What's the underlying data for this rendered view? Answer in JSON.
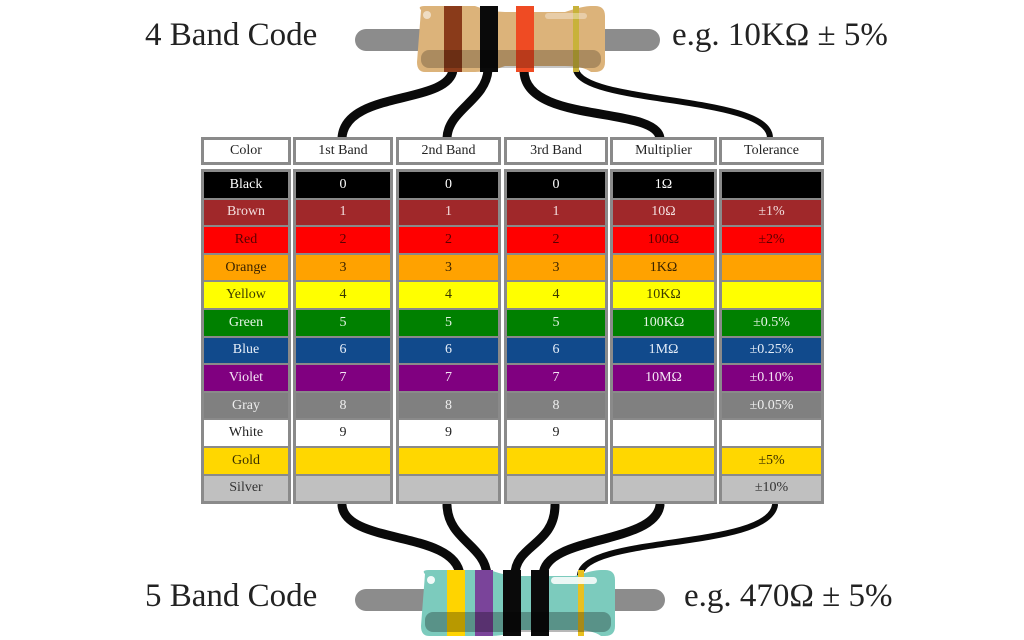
{
  "top": {
    "title": "4 Band Code",
    "example": "e.g.  10KΩ ± 5%",
    "body_color": "#dcb37a",
    "bands": [
      {
        "name": "brown",
        "color": "#8a3b1a"
      },
      {
        "name": "black",
        "color": "#0a0a0a"
      },
      {
        "name": "orange",
        "color": "#ef4b23"
      },
      {
        "name": "gold",
        "color": "#c8b23a"
      }
    ]
  },
  "bottom": {
    "title": "5 Band Code",
    "example": "e.g.  470Ω ± 5%",
    "body_color": "#7ccbbd",
    "bands": [
      {
        "name": "yellow",
        "color": "#ffd400"
      },
      {
        "name": "violet",
        "color": "#7a449a"
      },
      {
        "name": "black",
        "color": "#0a0a0a"
      },
      {
        "name": "black",
        "color": "#0a0a0a"
      },
      {
        "name": "gold",
        "color": "#e8c020"
      }
    ]
  },
  "table": {
    "headers": [
      "Color",
      "1st Band",
      "2nd Band",
      "3rd Band",
      "Multiplier",
      "Tolerance"
    ],
    "rows": [
      {
        "color": "Black",
        "bg": "#000000",
        "fg": "#ffffff",
        "first": "0",
        "second": "0",
        "third": "0",
        "multiplier": "1Ω",
        "tolerance": ""
      },
      {
        "color": "Brown",
        "bg": "#a0282a",
        "fg": "#f2dede",
        "first": "1",
        "second": "1",
        "third": "1",
        "multiplier": "10Ω",
        "tolerance": "±1%"
      },
      {
        "color": "Red",
        "bg": "#ff0000",
        "fg": "#5a0000",
        "first": "2",
        "second": "2",
        "third": "2",
        "multiplier": "100Ω",
        "tolerance": "±2%"
      },
      {
        "color": "Orange",
        "bg": "#ffa200",
        "fg": "#3a2400",
        "first": "3",
        "second": "3",
        "third": "3",
        "multiplier": "1KΩ",
        "tolerance": ""
      },
      {
        "color": "Yellow",
        "bg": "#ffff00",
        "fg": "#3a3a00",
        "first": "4",
        "second": "4",
        "third": "4",
        "multiplier": "10KΩ",
        "tolerance": ""
      },
      {
        "color": "Green",
        "bg": "#008000",
        "fg": "#e6f4e6",
        "first": "5",
        "second": "5",
        "third": "5",
        "multiplier": "100KΩ",
        "tolerance": "±0.5%"
      },
      {
        "color": "Blue",
        "bg": "#114a8c",
        "fg": "#e6eef8",
        "first": "6",
        "second": "6",
        "third": "6",
        "multiplier": "1MΩ",
        "tolerance": "±0.25%"
      },
      {
        "color": "Violet",
        "bg": "#800080",
        "fg": "#f4e6f4",
        "first": "7",
        "second": "7",
        "third": "7",
        "multiplier": "10MΩ",
        "tolerance": "±0.10%"
      },
      {
        "color": "Gray",
        "bg": "#808080",
        "fg": "#eeeeee",
        "first": "8",
        "second": "8",
        "third": "8",
        "multiplier": "",
        "tolerance": "±0.05%"
      },
      {
        "color": "White",
        "bg": "#ffffff",
        "fg": "#222222",
        "first": "9",
        "second": "9",
        "third": "9",
        "multiplier": "",
        "tolerance": ""
      },
      {
        "color": "Gold",
        "bg": "#ffd700",
        "fg": "#3a3000",
        "first": "",
        "second": "",
        "third": "",
        "multiplier": "",
        "tolerance": "±5%"
      },
      {
        "color": "Silver",
        "bg": "#c0c0c0",
        "fg": "#333333",
        "first": "",
        "second": "",
        "third": "",
        "multiplier": "",
        "tolerance": "±10%"
      }
    ]
  }
}
